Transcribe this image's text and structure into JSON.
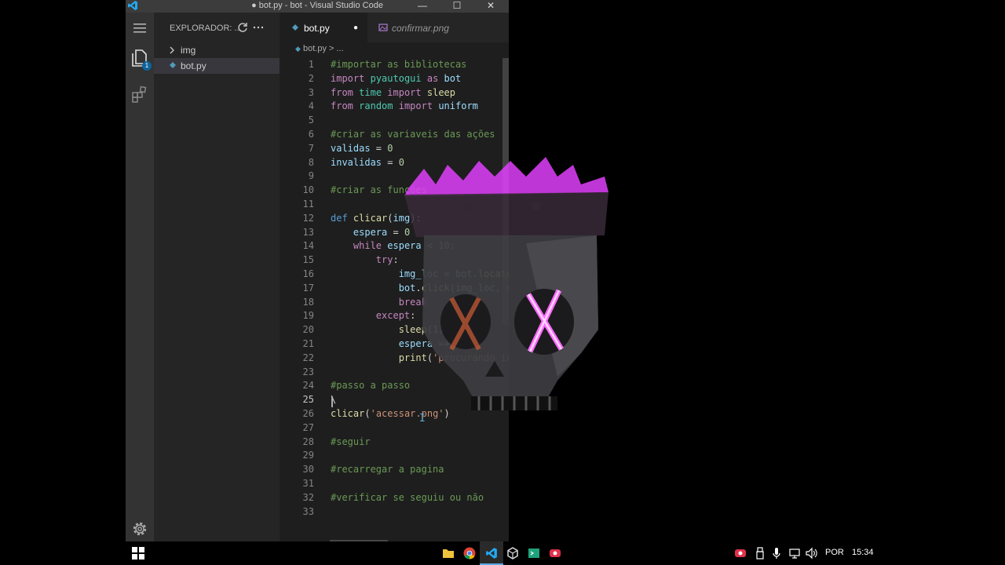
{
  "window": {
    "title": "● bot.py - bot - Visual Studio Code",
    "controls": {
      "minimize": "—",
      "maximize": "☐",
      "close": "✕"
    }
  },
  "activity_bar": {
    "explorer_badge": "1"
  },
  "sidebar": {
    "header": "EXPLORADOR: ...",
    "items": [
      {
        "label": "img",
        "type": "folder"
      },
      {
        "label": "bot.py",
        "type": "file",
        "selected": true
      }
    ]
  },
  "tabs": [
    {
      "label": "bot.py",
      "active": true,
      "modified": true
    },
    {
      "label": "confirmar.png",
      "active": false,
      "italic": true
    }
  ],
  "breadcrumb": {
    "file": "bot.py",
    "rest": "> ..."
  },
  "editor": {
    "current_line": 25,
    "lines": [
      {
        "n": "1",
        "text": "#importar as bibliotecas"
      },
      {
        "n": "2",
        "text": "import pyautogui as bot"
      },
      {
        "n": "3",
        "text": "from time import sleep"
      },
      {
        "n": "4",
        "text": "from random import uniform"
      },
      {
        "n": "5",
        "text": ""
      },
      {
        "n": "6",
        "text": "#criar as variaveis das ações"
      },
      {
        "n": "7",
        "text": "validas = 0"
      },
      {
        "n": "8",
        "text": "invalidas = 0"
      },
      {
        "n": "9",
        "text": ""
      },
      {
        "n": "10",
        "text": "#criar as funções"
      },
      {
        "n": "11",
        "text": ""
      },
      {
        "n": "12",
        "text": "def clicar(img):"
      },
      {
        "n": "13",
        "text": "    espera = 0"
      },
      {
        "n": "14",
        "text": "    while espera < 10:"
      },
      {
        "n": "15",
        "text": "        try:"
      },
      {
        "n": "16",
        "text": "            img_loc = bot.locate"
      },
      {
        "n": "17",
        "text": "            bot.click(img_loc, d"
      },
      {
        "n": "18",
        "text": "            break"
      },
      {
        "n": "19",
        "text": "        except:"
      },
      {
        "n": "20",
        "text": "            sleep(1)"
      },
      {
        "n": "21",
        "text": "            espera =+ 1"
      },
      {
        "n": "22",
        "text": "            print('procurando in"
      },
      {
        "n": "23",
        "text": ""
      },
      {
        "n": "24",
        "text": "#passo a passo"
      },
      {
        "n": "25",
        "text": "\\"
      },
      {
        "n": "26",
        "text": "clicar('acessar.png')"
      },
      {
        "n": "27",
        "text": ""
      },
      {
        "n": "28",
        "text": "#seguir"
      },
      {
        "n": "29",
        "text": ""
      },
      {
        "n": "30",
        "text": "#recarregar a pagina"
      },
      {
        "n": "31",
        "text": ""
      },
      {
        "n": "32",
        "text": "#verificar se seguiu ou não"
      },
      {
        "n": "33",
        "text": ""
      }
    ]
  },
  "taskbar": {
    "tray": {
      "language": "POR",
      "time": "15:34"
    }
  },
  "colors": {
    "keyword": "#c586c0",
    "def": "#569cd6",
    "function": "#dcdcaa",
    "variable": "#9cdcfe",
    "number": "#b5cea8",
    "string": "#ce9178",
    "comment": "#6a9955",
    "module": "#4ec9b0",
    "watermark": "#e040fb"
  }
}
